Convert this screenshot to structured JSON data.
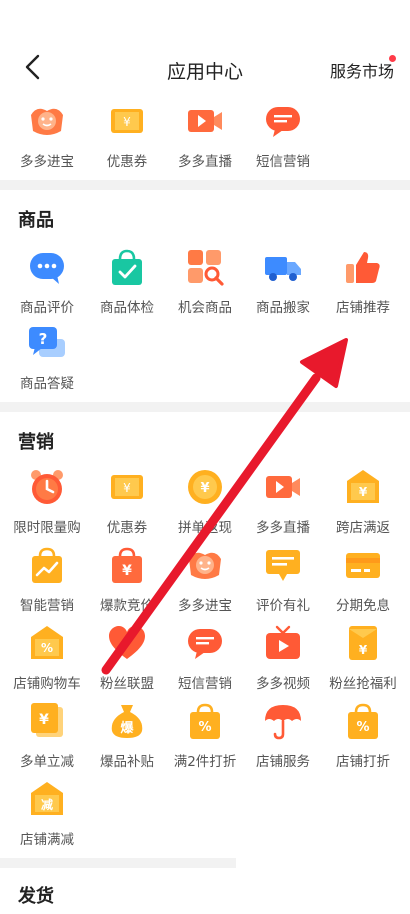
{
  "header": {
    "title": "应用中心",
    "service_market": "服务市场"
  },
  "top_row": [
    {
      "label": "多多进宝",
      "icon": "mascot-coin-icon"
    },
    {
      "label": "优惠券",
      "icon": "coupon-icon"
    },
    {
      "label": "多多直播",
      "icon": "live-video-icon"
    },
    {
      "label": "短信营销",
      "icon": "sms-bubble-icon"
    }
  ],
  "goods": {
    "title": "商品",
    "items": [
      {
        "label": "商品评价",
        "icon": "chat-bubble-icon"
      },
      {
        "label": "商品体检",
        "icon": "shopping-bag-check-icon"
      },
      {
        "label": "机会商品",
        "icon": "grid-search-icon"
      },
      {
        "label": "商品搬家",
        "icon": "truck-icon"
      },
      {
        "label": "店铺推荐",
        "icon": "thumbs-up-icon"
      },
      {
        "label": "商品答疑",
        "icon": "question-bubble-icon"
      }
    ]
  },
  "marketing": {
    "title": "营销",
    "items": [
      {
        "label": "限时限量购",
        "icon": "alarm-clock-icon"
      },
      {
        "label": "优惠券",
        "icon": "coupon-icon"
      },
      {
        "label": "拼单返现",
        "icon": "yuan-coin-icon"
      },
      {
        "label": "多多直播",
        "icon": "live-video-icon"
      },
      {
        "label": "跨店满返",
        "icon": "yuan-tag-icon"
      },
      {
        "label": "智能营销",
        "icon": "trend-bag-icon"
      },
      {
        "label": "爆款竞价",
        "icon": "yuan-bag-icon"
      },
      {
        "label": "多多进宝",
        "icon": "mascot-coin-icon"
      },
      {
        "label": "评价有礼",
        "icon": "comment-gift-icon"
      },
      {
        "label": "分期免息",
        "icon": "credit-card-icon"
      },
      {
        "label": "店铺购物车",
        "icon": "percent-tag-icon"
      },
      {
        "label": "粉丝联盟",
        "icon": "heart-icon"
      },
      {
        "label": "短信营销",
        "icon": "sms-bubble-icon"
      },
      {
        "label": "多多视频",
        "icon": "tv-play-icon"
      },
      {
        "label": "粉丝抢福利",
        "icon": "red-envelope-icon"
      },
      {
        "label": "多单立减",
        "icon": "yuan-ticket-icon"
      },
      {
        "label": "爆品补贴",
        "icon": "money-bag-icon"
      },
      {
        "label": "满2件打折",
        "icon": "discount-bag-icon"
      },
      {
        "label": "店铺服务",
        "icon": "umbrella-icon"
      },
      {
        "label": "店铺打折",
        "icon": "discount-bag-icon"
      },
      {
        "label": "店铺满减",
        "icon": "minus-tag-icon"
      }
    ]
  },
  "shipping": {
    "title": "发货"
  },
  "colors": {
    "orange": "#ff8a1f",
    "red": "#ff4d3b",
    "blue": "#3d8bff",
    "teal": "#19c7a2",
    "arrow": "#e8192c"
  },
  "icon_text": {
    "yuan": "¥",
    "bao": "爆",
    "jian": "减",
    "percent": "%",
    "question": "?"
  }
}
